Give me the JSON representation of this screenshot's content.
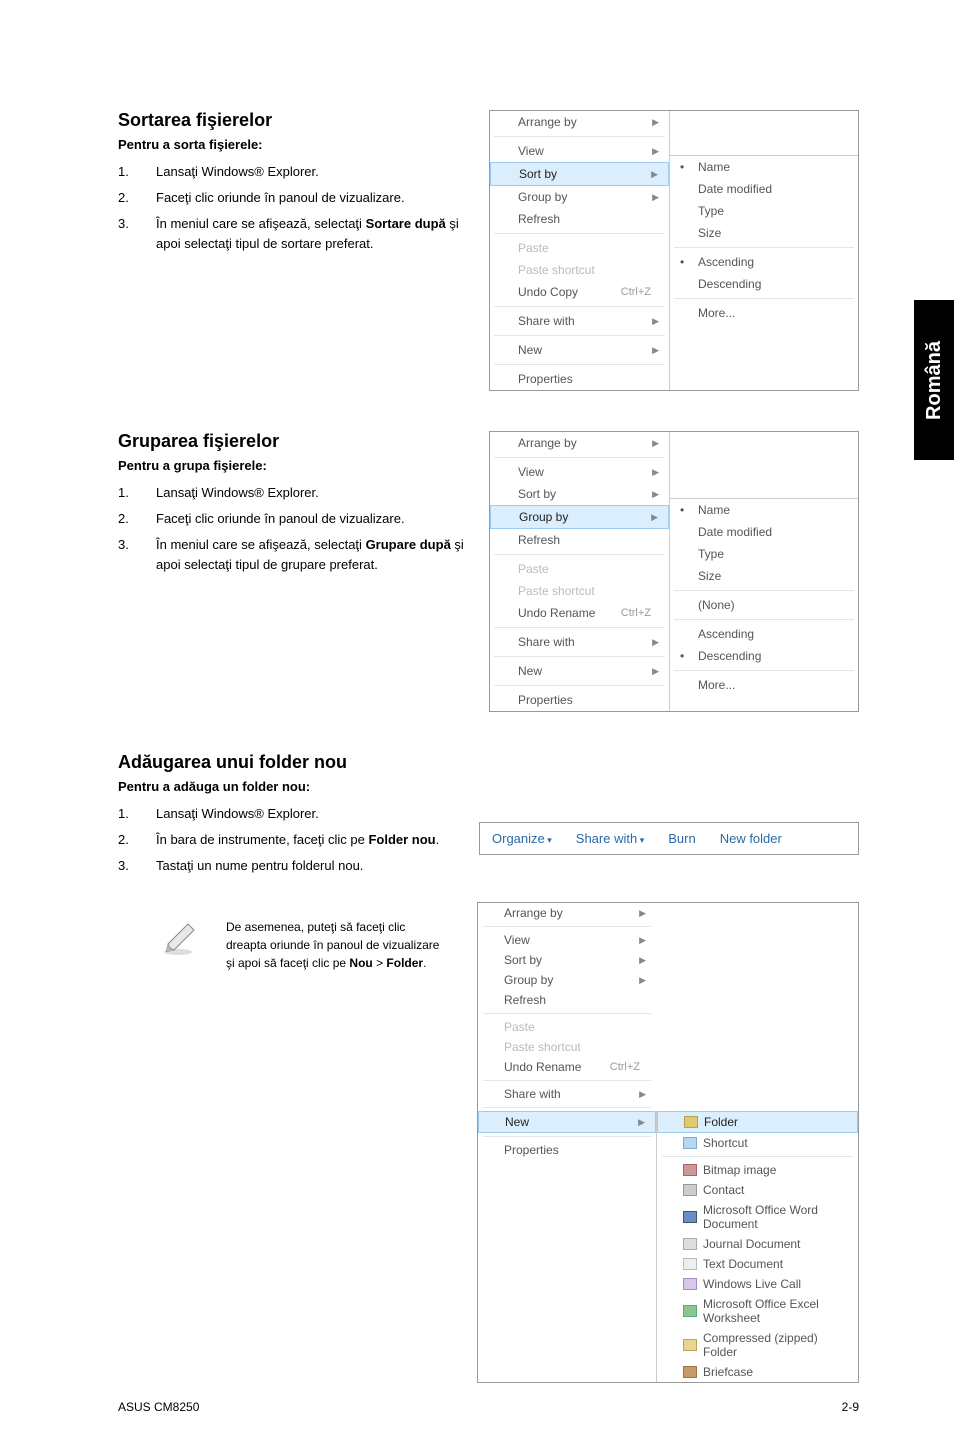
{
  "sidebar_label": "Română",
  "sections": {
    "sort": {
      "heading": "Sortarea fişierelor",
      "sub": "Pentru a sorta fişierele:",
      "steps": [
        {
          "num": "1.",
          "txt": "Lansaţi Windows® Explorer."
        },
        {
          "num": "2.",
          "txt": "Faceţi clic oriunde în panoul de vizualizare."
        },
        {
          "num": "3.",
          "pre": "În meniul care se afişează, selectaţi ",
          "bold": "Sortare după",
          "post": " şi apoi selectaţi tipul de sortare preferat."
        }
      ]
    },
    "group": {
      "heading": "Gruparea fişierelor",
      "sub": "Pentru a grupa fişierele:",
      "steps": [
        {
          "num": "1.",
          "txt": "Lansaţi Windows® Explorer."
        },
        {
          "num": "2.",
          "txt": "Faceţi clic oriunde în panoul de vizualizare."
        },
        {
          "num": "3.",
          "pre": "În meniul care se afişează, selectaţi ",
          "bold": "Grupare după",
          "post": " şi apoi selectaţi tipul de grupare preferat."
        }
      ]
    },
    "folder": {
      "heading": "Adăugarea unui folder nou",
      "sub": "Pentru a adăuga un folder nou:",
      "steps": [
        {
          "num": "1.",
          "txt": "Lansaţi Windows® Explorer."
        },
        {
          "num": "2.",
          "pre": "În bara de instrumente, faceţi clic pe ",
          "bold": "Folder nou",
          "post": "."
        },
        {
          "num": "3.",
          "txt": "Tastaţi un nume pentru folderul nou."
        }
      ],
      "note": "De asemenea, puteţi să faceţi clic dreapta oriunde în panoul de vizualizare şi apoi să faceţi clic pe ",
      "note_bold1": "Nou",
      "note_sep": " > ",
      "note_bold2": "Folder",
      "note_end": "."
    }
  },
  "menu1": {
    "arrange": "Arrange by",
    "view": "View",
    "sort": "Sort by",
    "group": "Group by",
    "refresh": "Refresh",
    "paste": "Paste",
    "paste_shortcut": "Paste shortcut",
    "undo": "Undo Copy",
    "undo_kbd": "Ctrl+Z",
    "share": "Share with",
    "new": "New",
    "props": "Properties",
    "sub_name": "Name",
    "sub_date": "Date modified",
    "sub_type": "Type",
    "sub_size": "Size",
    "sub_asc": "Ascending",
    "sub_desc": "Descending",
    "sub_more": "More..."
  },
  "menu2": {
    "arrange": "Arrange by",
    "view": "View",
    "sort": "Sort by",
    "group": "Group by",
    "refresh": "Refresh",
    "paste": "Paste",
    "paste_shortcut": "Paste shortcut",
    "undo": "Undo Rename",
    "undo_kbd": "Ctrl+Z",
    "share": "Share with",
    "new": "New",
    "props": "Properties",
    "sub_name": "Name",
    "sub_date": "Date modified",
    "sub_type": "Type",
    "sub_size": "Size",
    "sub_none": "(None)",
    "sub_asc": "Ascending",
    "sub_desc": "Descending",
    "sub_more": "More..."
  },
  "toolbar": {
    "organize": "Organize",
    "share": "Share with",
    "burn": "Burn",
    "newfolder": "New folder"
  },
  "menu3": {
    "arrange": "Arrange by",
    "view": "View",
    "sort": "Sort by",
    "group": "Group by",
    "refresh": "Refresh",
    "paste": "Paste",
    "paste_shortcut": "Paste shortcut",
    "undo": "Undo Rename",
    "undo_kbd": "Ctrl+Z",
    "share": "Share with",
    "new": "New",
    "props": "Properties",
    "sub_folder": "Folder",
    "sub_shortcut": "Shortcut",
    "sub_bmp": "Bitmap image",
    "sub_contact": "Contact",
    "sub_word": "Microsoft Office Word Document",
    "sub_journal": "Journal Document",
    "sub_text": "Text Document",
    "sub_cell": "Windows Live Call",
    "sub_excel": "Microsoft Office Excel Worksheet",
    "sub_zip": "Compressed (zipped) Folder",
    "sub_brief": "Briefcase"
  },
  "footer": {
    "left": "ASUS CM8250",
    "right": "2-9"
  }
}
